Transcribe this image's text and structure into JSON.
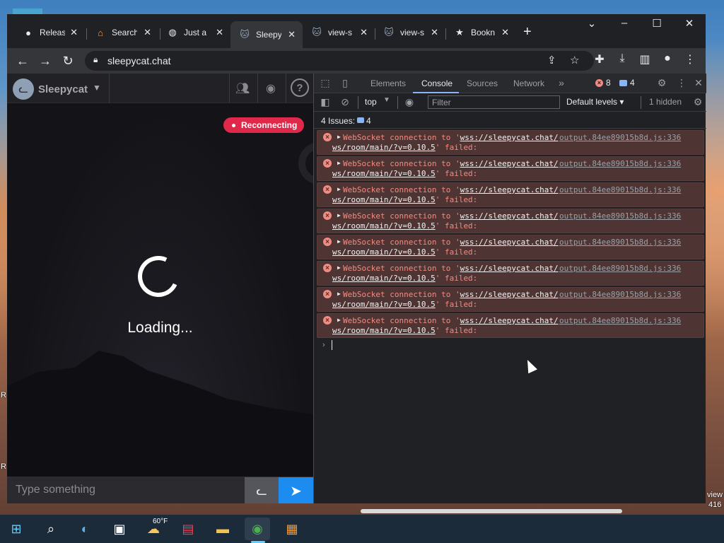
{
  "desktop": {
    "right_text_1": "view",
    "right_text_2": "416",
    "left_text_1": "R",
    "left_text_2": "R"
  },
  "browser": {
    "tabs": [
      {
        "title": "Releas",
        "icon": "github-icon"
      },
      {
        "title": "Search",
        "icon": "search-home-icon"
      },
      {
        "title": "Just a",
        "icon": "globe-icon"
      },
      {
        "title": "Sleepy",
        "icon": "cat-icon",
        "active": true
      },
      {
        "title": "view-s",
        "icon": "cat-icon"
      },
      {
        "title": "view-s",
        "icon": "cat-icon"
      },
      {
        "title": "Bookn",
        "icon": "star-icon"
      }
    ],
    "url": "sleepycat.chat"
  },
  "sleepycat": {
    "app_name": "Sleepycat",
    "status_badge": "Reconnecting",
    "loading_text": "Loading...",
    "input_placeholder": "Type something",
    "accent": "#1d8cf0",
    "badge_color": "#e0294a"
  },
  "devtools": {
    "tabs": [
      "Elements",
      "Console",
      "Sources",
      "Network"
    ],
    "active_tab": "Console",
    "error_count": "8",
    "issue_count": "4",
    "context": "top",
    "filter_placeholder": "Filter",
    "levels": "Default levels",
    "hidden": "1 hidden",
    "issues_label": "4 Issues:",
    "issues_count": "4",
    "messages": [
      {
        "pre": "WebSocket connection to '",
        "url1": "wss://sleepycat.chat/",
        "url2": "ws/room/main/?v=0.10.5",
        "post": "' failed:",
        "source": "output.84ee89015b8d.js:336"
      },
      {
        "pre": "WebSocket connection to '",
        "url1": "wss://sleepycat.chat/",
        "url2": "ws/room/main/?v=0.10.5",
        "post": "' failed:",
        "source": "output.84ee89015b8d.js:336"
      },
      {
        "pre": "WebSocket connection to '",
        "url1": "wss://sleepycat.chat/",
        "url2": "ws/room/main/?v=0.10.5",
        "post": "' failed:",
        "source": "output.84ee89015b8d.js:336"
      },
      {
        "pre": "WebSocket connection to '",
        "url1": "wss://sleepycat.chat/",
        "url2": "ws/room/main/?v=0.10.5",
        "post": "' failed:",
        "source": "output.84ee89015b8d.js:336"
      },
      {
        "pre": "WebSocket connection to '",
        "url1": "wss://sleepycat.chat/",
        "url2": "ws/room/main/?v=0.10.5",
        "post": "' failed:",
        "source": "output.84ee89015b8d.js:336"
      },
      {
        "pre": "WebSocket connection to '",
        "url1": "wss://sleepycat.chat/",
        "url2": "ws/room/main/?v=0.10.5",
        "post": "' failed:",
        "source": "output.84ee89015b8d.js:336"
      },
      {
        "pre": "WebSocket connection to '",
        "url1": "wss://sleepycat.chat/",
        "url2": "ws/room/main/?v=0.10.5",
        "post": "' failed:",
        "source": "output.84ee89015b8d.js:336"
      },
      {
        "pre": "WebSocket connection to '",
        "url1": "wss://sleepycat.chat/",
        "url2": "ws/room/main/?v=0.10.5",
        "post": "' failed:",
        "source": "output.84ee89015b8d.js:336"
      }
    ]
  },
  "taskbar": {
    "weather": "60°F",
    "apps": [
      "windows-start-icon",
      "search-icon",
      "edge-pre-icon",
      "task-view-icon",
      "weather-icon",
      "news-icon",
      "file-explorer-icon",
      "chrome-icon",
      "app-icon"
    ]
  }
}
